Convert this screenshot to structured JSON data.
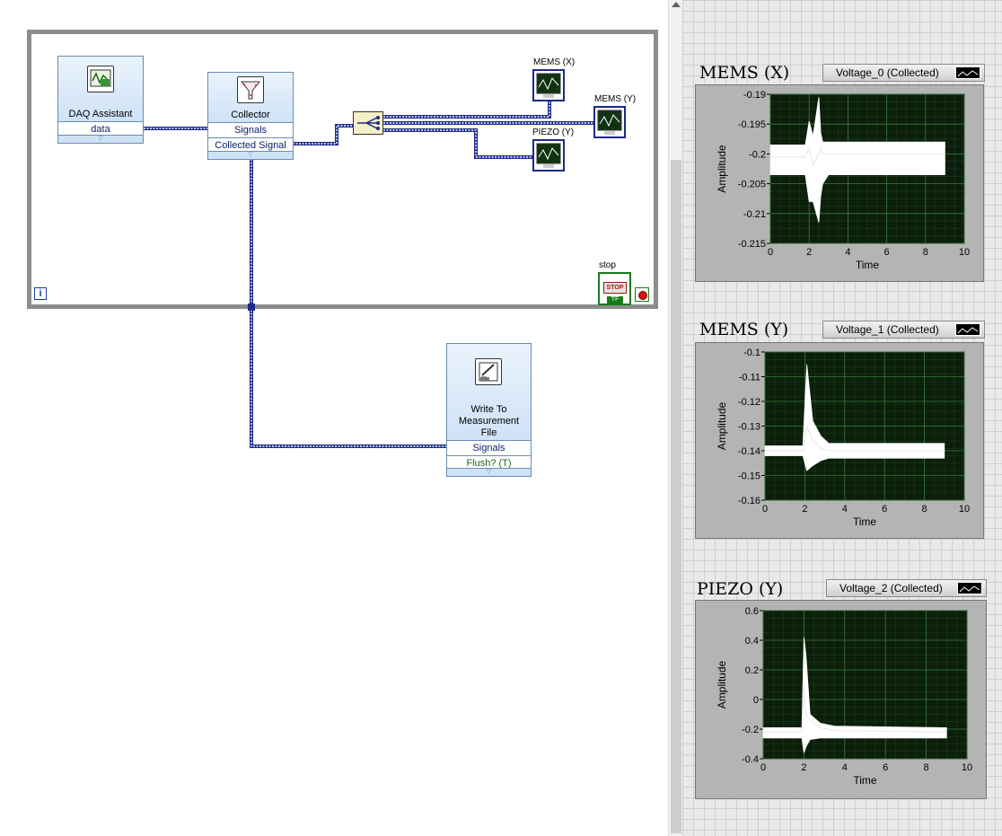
{
  "block_diagram": {
    "daq_assistant": {
      "title": "DAQ Assistant",
      "terminal": "data"
    },
    "collector": {
      "title": "Collector",
      "terminals": [
        "Signals",
        "Collected Signal"
      ]
    },
    "write_file": {
      "title_lines": [
        "Write To",
        "Measurement",
        "File"
      ],
      "terminals": [
        "Signals",
        "Flush? (T)"
      ]
    },
    "indicators": {
      "mems_x": "MEMS (X)",
      "mems_y": "MEMS (Y)",
      "piezo_y": "PIEZO (Y)"
    },
    "stop": {
      "label": "stop",
      "button_text": "STOP",
      "tf": "TF"
    },
    "loop_iteration": "i"
  },
  "front_panel": {
    "graphs": [
      {
        "title": "MEMS (X)",
        "legend": "Voltage_0 (Collected)",
        "ylabel": "Amplitude",
        "xlabel": "Time"
      },
      {
        "title": "MEMS (Y)",
        "legend": "Voltage_1 (Collected)",
        "ylabel": "Amplitude",
        "xlabel": "Time"
      },
      {
        "title": "PIEZO (Y)",
        "legend": "Voltage_2 (Collected)",
        "ylabel": "Amplitude",
        "xlabel": "Time"
      }
    ]
  },
  "chart_data": [
    {
      "type": "line",
      "title": "MEMS (X)",
      "xlabel": "Time",
      "ylabel": "Amplitude",
      "xlim": [
        0,
        10
      ],
      "ylim": [
        -0.215,
        -0.19
      ],
      "xticks": [
        "0",
        "2",
        "4",
        "6",
        "8",
        "10"
      ],
      "yticks": [
        "-0.19",
        "-0.195",
        "-0.2",
        "-0.205",
        "-0.21",
        "-0.215"
      ],
      "series": [
        {
          "name": "Voltage_0 (Collected)",
          "x": [
            0,
            1.8,
            2.0,
            2.2,
            2.5,
            2.6,
            2.7,
            3.0,
            9.0
          ],
          "y_center": [
            -0.2005,
            -0.2005,
            -0.199,
            -0.202,
            -0.2,
            -0.199,
            -0.2,
            -0.2,
            -0.2
          ],
          "y_upper": [
            -0.1985,
            -0.1985,
            -0.1945,
            -0.197,
            -0.1905,
            -0.1965,
            -0.198,
            -0.198,
            -0.198
          ],
          "y_lower": [
            -0.2035,
            -0.2035,
            -0.208,
            -0.208,
            -0.2115,
            -0.207,
            -0.205,
            -0.2035,
            -0.2035
          ]
        }
      ],
      "grid": true
    },
    {
      "type": "line",
      "title": "MEMS (Y)",
      "xlabel": "Time",
      "ylabel": "Amplitude",
      "xlim": [
        0,
        10
      ],
      "ylim": [
        -0.16,
        -0.1
      ],
      "xticks": [
        "0",
        "2",
        "4",
        "6",
        "8",
        "10"
      ],
      "yticks": [
        "-0.1",
        "-0.11",
        "-0.12",
        "-0.13",
        "-0.14",
        "-0.15",
        "-0.16"
      ],
      "series": [
        {
          "name": "Voltage_1 (Collected)",
          "x": [
            0,
            1.9,
            2.1,
            2.4,
            2.8,
            3.2,
            9.0
          ],
          "y_center": [
            -0.14,
            -0.14,
            -0.13,
            -0.136,
            -0.139,
            -0.14,
            -0.14
          ],
          "y_upper": [
            -0.138,
            -0.138,
            -0.105,
            -0.128,
            -0.134,
            -0.137,
            -0.137
          ],
          "y_lower": [
            -0.142,
            -0.142,
            -0.148,
            -0.146,
            -0.144,
            -0.143,
            -0.143
          ]
        }
      ],
      "grid": true
    },
    {
      "type": "line",
      "title": "PIEZO (Y)",
      "xlabel": "Time",
      "ylabel": "Amplitude",
      "xlim": [
        0,
        10
      ],
      "ylim": [
        -0.4,
        0.6
      ],
      "xticks": [
        "0",
        "2",
        "4",
        "6",
        "8",
        "10"
      ],
      "yticks": [
        "0.6",
        "0.4",
        "0.2",
        "0",
        "-0.2",
        "-0.4"
      ],
      "series": [
        {
          "name": "Voltage_2 (Collected)",
          "x": [
            0,
            1.9,
            2.0,
            2.1,
            2.3,
            2.8,
            3.5,
            9.0
          ],
          "y_center": [
            -0.22,
            -0.22,
            0.1,
            -0.1,
            -0.14,
            -0.19,
            -0.21,
            -0.22
          ],
          "y_upper": [
            -0.19,
            -0.19,
            0.42,
            0.3,
            -0.1,
            -0.16,
            -0.18,
            -0.19
          ],
          "y_lower": [
            -0.26,
            -0.26,
            -0.36,
            -0.32,
            -0.27,
            -0.26,
            -0.26,
            -0.26
          ]
        }
      ],
      "grid": true
    }
  ]
}
